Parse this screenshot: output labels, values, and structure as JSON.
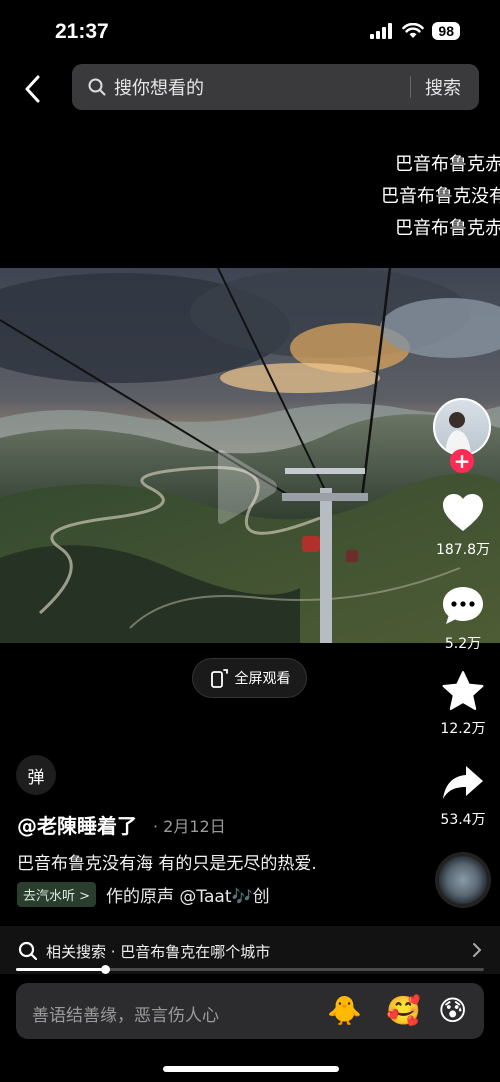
{
  "status": {
    "time": "21:37",
    "battery": "98"
  },
  "search": {
    "placeholder": "搜你想看的",
    "button": "搜索"
  },
  "danmaku": [
    "巴音布鲁克赤",
    "巴音布鲁克没有",
    "巴音布鲁克赤"
  ],
  "video": {
    "fullscreen_label": "全屏观看"
  },
  "actions": {
    "likes": "187.8万",
    "comments": "5.2万",
    "favorites": "12.2万",
    "shares": "53.4万"
  },
  "danmaku_toggle": "弹",
  "post": {
    "author": "@老陳睡着了",
    "date": "· 2月12日",
    "description": "巴音布鲁克没有海 有的只是无尽的热爱.",
    "music_tag": "去汽水听 >",
    "music_text": "作的原声    @Taat🎶创"
  },
  "related": {
    "text": "相关搜索 · 巴音布鲁克在哪个城市"
  },
  "progress": {
    "fraction": 0.19
  },
  "comment": {
    "placeholder": "善语结善缘，恶言伤人心"
  },
  "emojis": [
    "🐥",
    "🥰",
    "😰"
  ]
}
